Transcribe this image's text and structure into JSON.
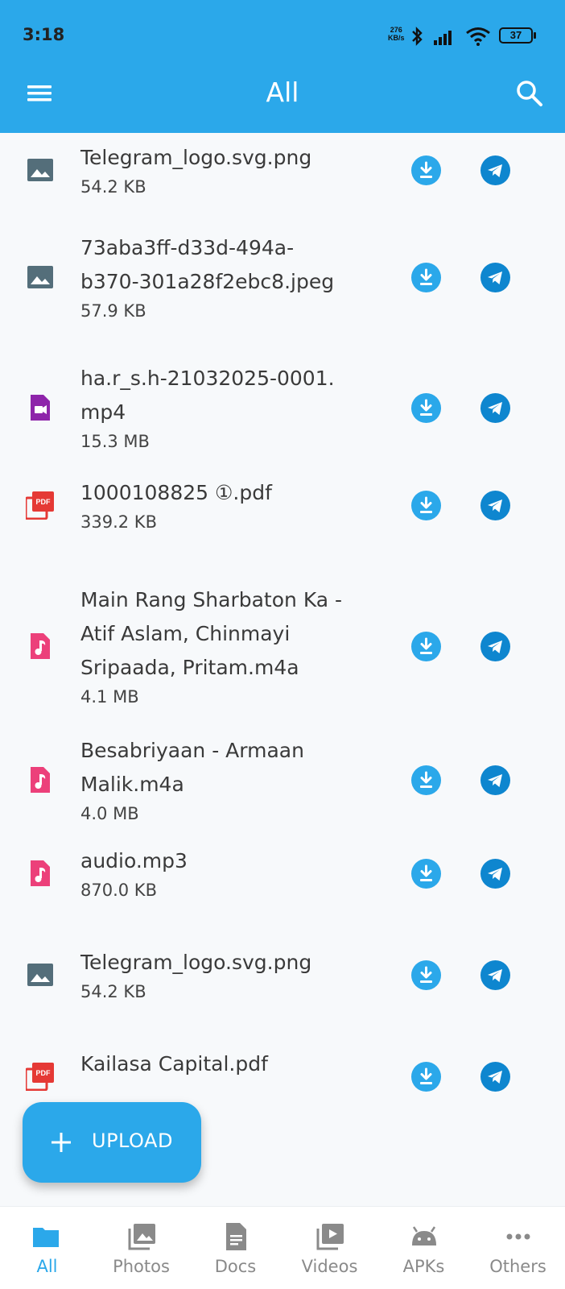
{
  "status_bar": {
    "time": "3:18",
    "net_speed_value": "276",
    "net_speed_unit": "KB/s",
    "battery": "37"
  },
  "app_bar": {
    "title": "All"
  },
  "files": [
    {
      "name_lines": [
        "Telegram_logo.svg.png"
      ],
      "size": "54.2 KB",
      "type": "image"
    },
    {
      "name_lines": [
        "73aba3ff-d33d-494a-",
        "b370-301a28f2ebc8.jpeg"
      ],
      "size": "57.9 KB",
      "type": "image"
    },
    {
      "name_lines": [
        "ha.r_s.h-21032025-0001.",
        "mp4"
      ],
      "size": "15.3 MB",
      "type": "video"
    },
    {
      "name_lines": [
        "1000108825 ①.pdf"
      ],
      "size": "339.2 KB",
      "type": "pdf"
    },
    {
      "name_lines": [
        "Main Rang Sharbaton Ka -",
        "Atif Aslam, Chinmayi",
        "Sripaada, Pritam.m4a"
      ],
      "size": "4.1 MB",
      "type": "audio"
    },
    {
      "name_lines": [
        "Besabriyaan - Armaan",
        "Malik.m4a"
      ],
      "size": "4.0 MB",
      "type": "audio"
    },
    {
      "name_lines": [
        "audio.mp3"
      ],
      "size": "870.0 KB",
      "type": "audio"
    },
    {
      "name_lines": [
        "Telegram_logo.svg.png"
      ],
      "size": "54.2 KB",
      "type": "image"
    },
    {
      "name_lines": [
        "Kailasa Capital.pdf"
      ],
      "size": "",
      "type": "pdf"
    }
  ],
  "fab": {
    "label": "UPLOAD"
  },
  "nav": [
    {
      "label": "All",
      "icon": "folder-icon",
      "active": true
    },
    {
      "label": "Photos",
      "icon": "photos-icon",
      "active": false
    },
    {
      "label": "Docs",
      "icon": "docs-icon",
      "active": false
    },
    {
      "label": "Videos",
      "icon": "videos-icon",
      "active": false
    },
    {
      "label": "APKs",
      "icon": "android-icon",
      "active": false
    },
    {
      "label": "Others",
      "icon": "more-dots-icon",
      "active": false
    }
  ],
  "colors": {
    "primary": "#2ba8ea",
    "telegram": "#0e86cf",
    "image_icon": "#546e7a",
    "video_icon": "#8e24aa",
    "pdf_icon": "#e53935",
    "audio_icon": "#ec407a"
  }
}
